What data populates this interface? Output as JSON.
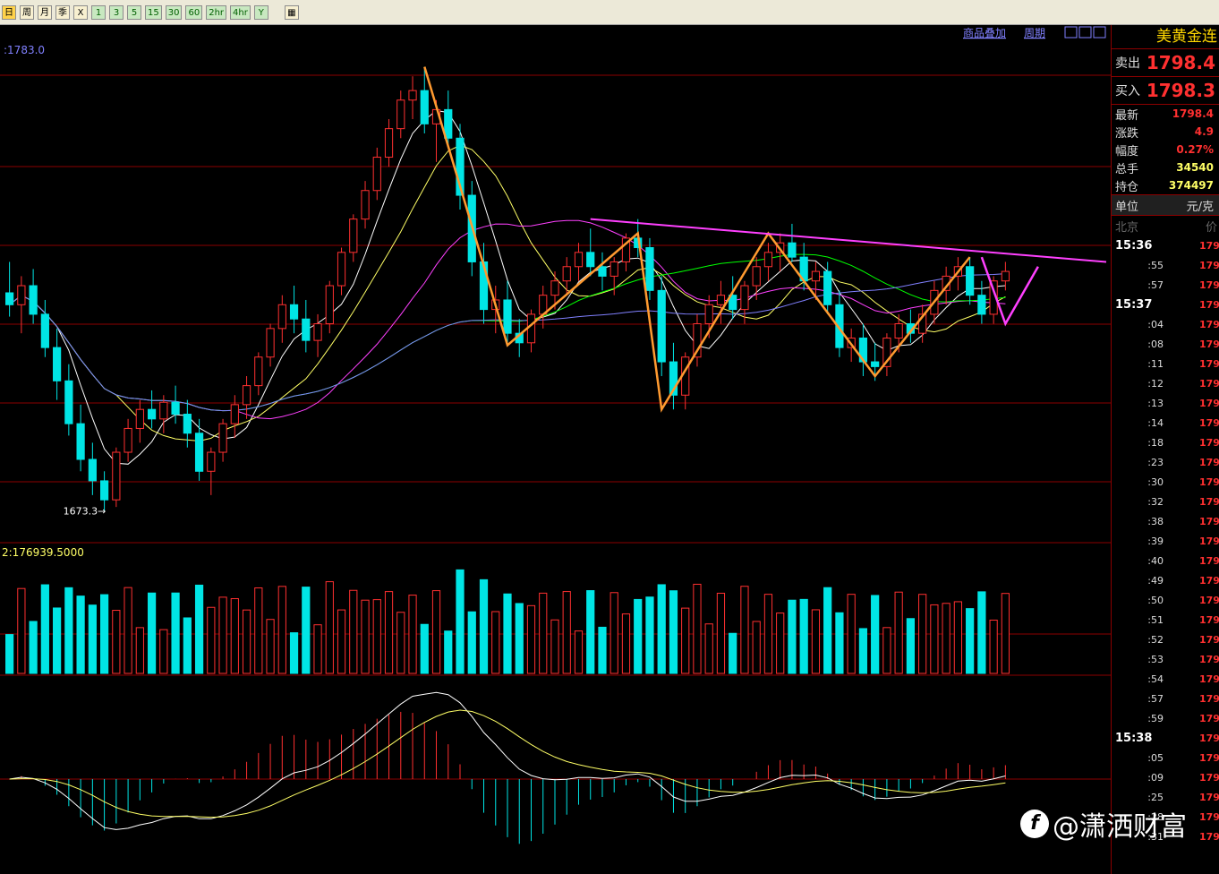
{
  "toolbar": {
    "buttons": [
      {
        "label": "日",
        "active": true
      },
      {
        "label": "周"
      },
      {
        "label": "月"
      },
      {
        "label": "季"
      },
      {
        "label": "X"
      },
      {
        "label": "1",
        "green": true
      },
      {
        "label": "3",
        "green": true
      },
      {
        "label": "5",
        "green": true
      },
      {
        "label": "15",
        "green": true
      },
      {
        "label": "30",
        "green": true
      },
      {
        "label": "60",
        "green": true
      },
      {
        "label": "2hr",
        "green": true
      },
      {
        "label": "4hr",
        "green": true
      },
      {
        "label": "Y",
        "green": true
      }
    ],
    "extra_icon": "grid-icon"
  },
  "chart_header": {
    "overlay_link": "商品叠加",
    "period_link": "周期",
    "nav_icons": [
      "prev-icon",
      "next-icon",
      "expand-icon"
    ]
  },
  "chart_data": {
    "type": "candlestick",
    "price_label": ":1783.0",
    "low_label": "1673.3",
    "volume_label": "2:176939.5000",
    "ohlc": [
      [
        1765,
        1778,
        1755,
        1760
      ],
      [
        1760,
        1772,
        1748,
        1768
      ],
      [
        1768,
        1775,
        1752,
        1756
      ],
      [
        1756,
        1762,
        1738,
        1742
      ],
      [
        1742,
        1750,
        1720,
        1728
      ],
      [
        1728,
        1735,
        1705,
        1710
      ],
      [
        1710,
        1718,
        1690,
        1695
      ],
      [
        1695,
        1702,
        1680,
        1686
      ],
      [
        1686,
        1690,
        1673.3,
        1678
      ],
      [
        1678,
        1700,
        1675,
        1698
      ],
      [
        1698,
        1712,
        1694,
        1708
      ],
      [
        1708,
        1720,
        1702,
        1716
      ],
      [
        1716,
        1724,
        1708,
        1712
      ],
      [
        1712,
        1722,
        1706,
        1719
      ],
      [
        1719,
        1726,
        1710,
        1714
      ],
      [
        1714,
        1720,
        1700,
        1706
      ],
      [
        1706,
        1712,
        1686,
        1690
      ],
      [
        1690,
        1700,
        1680,
        1698
      ],
      [
        1698,
        1712,
        1694,
        1710
      ],
      [
        1710,
        1722,
        1704,
        1718
      ],
      [
        1718,
        1730,
        1712,
        1726
      ],
      [
        1726,
        1740,
        1722,
        1738
      ],
      [
        1738,
        1752,
        1734,
        1750
      ],
      [
        1750,
        1764,
        1744,
        1760
      ],
      [
        1760,
        1768,
        1748,
        1754
      ],
      [
        1754,
        1762,
        1740,
        1745
      ],
      [
        1745,
        1756,
        1738,
        1752
      ],
      [
        1752,
        1770,
        1748,
        1768
      ],
      [
        1768,
        1784,
        1764,
        1782
      ],
      [
        1782,
        1798,
        1778,
        1796
      ],
      [
        1796,
        1812,
        1792,
        1808
      ],
      [
        1808,
        1826,
        1804,
        1822
      ],
      [
        1822,
        1838,
        1818,
        1834
      ],
      [
        1834,
        1850,
        1830,
        1846
      ],
      [
        1846,
        1856,
        1838,
        1850
      ],
      [
        1850,
        1860,
        1832,
        1836
      ],
      [
        1836,
        1846,
        1820,
        1842
      ],
      [
        1842,
        1850,
        1826,
        1830
      ],
      [
        1830,
        1836,
        1800,
        1806
      ],
      [
        1806,
        1812,
        1772,
        1778
      ],
      [
        1778,
        1786,
        1752,
        1758
      ],
      [
        1758,
        1768,
        1748,
        1762
      ],
      [
        1762,
        1770,
        1744,
        1748
      ],
      [
        1748,
        1754,
        1738,
        1744
      ],
      [
        1744,
        1758,
        1740,
        1756
      ],
      [
        1756,
        1768,
        1750,
        1764
      ],
      [
        1764,
        1774,
        1758,
        1770
      ],
      [
        1770,
        1780,
        1764,
        1776
      ],
      [
        1776,
        1786,
        1770,
        1782
      ],
      [
        1782,
        1792,
        1772,
        1776
      ],
      [
        1776,
        1782,
        1766,
        1772
      ],
      [
        1772,
        1780,
        1764,
        1778
      ],
      [
        1778,
        1790,
        1774,
        1788
      ],
      [
        1788,
        1796,
        1780,
        1784
      ],
      [
        1784,
        1788,
        1762,
        1766
      ],
      [
        1766,
        1772,
        1730,
        1736
      ],
      [
        1736,
        1744,
        1716,
        1722
      ],
      [
        1722,
        1740,
        1716,
        1738
      ],
      [
        1738,
        1756,
        1734,
        1752
      ],
      [
        1752,
        1764,
        1746,
        1760
      ],
      [
        1760,
        1770,
        1752,
        1764
      ],
      [
        1764,
        1772,
        1754,
        1758
      ],
      [
        1758,
        1770,
        1752,
        1768
      ],
      [
        1768,
        1780,
        1762,
        1776
      ],
      [
        1776,
        1786,
        1770,
        1782
      ],
      [
        1782,
        1790,
        1774,
        1786
      ],
      [
        1786,
        1794,
        1778,
        1780
      ],
      [
        1780,
        1786,
        1766,
        1770
      ],
      [
        1770,
        1778,
        1762,
        1774
      ],
      [
        1774,
        1778,
        1756,
        1760
      ],
      [
        1760,
        1766,
        1738,
        1742
      ],
      [
        1742,
        1750,
        1736,
        1746
      ],
      [
        1746,
        1752,
        1730,
        1736
      ],
      [
        1736,
        1744,
        1728,
        1734
      ],
      [
        1734,
        1748,
        1730,
        1746
      ],
      [
        1746,
        1756,
        1740,
        1752
      ],
      [
        1752,
        1758,
        1744,
        1748
      ],
      [
        1748,
        1760,
        1744,
        1756
      ],
      [
        1756,
        1770,
        1752,
        1766
      ],
      [
        1766,
        1776,
        1760,
        1772
      ],
      [
        1772,
        1780,
        1766,
        1776
      ],
      [
        1776,
        1780,
        1760,
        1764
      ],
      [
        1764,
        1770,
        1752,
        1756
      ],
      [
        1756,
        1772,
        1752,
        1770
      ],
      [
        1770,
        1778,
        1766,
        1774
      ]
    ],
    "ma_colors": [
      "#FFFFFF",
      "#FFFF66",
      "#FF40FF",
      "#00FF00",
      "#8080FF"
    ],
    "trend_lines": {
      "orange_color": "#FF9A30",
      "magenta_color": "#FF40FF"
    }
  },
  "sidebar": {
    "title": "美黄金连",
    "sell_label": "卖出",
    "sell_value": "1798.4",
    "buy_label": "买入",
    "buy_value": "1798.3",
    "info": [
      {
        "label": "最新",
        "value": "1798.4",
        "color": "#FF3030"
      },
      {
        "label": "涨跌",
        "value": "4.9",
        "color": "#FF3030"
      },
      {
        "label": "幅度",
        "value": "0.27%",
        "color": "#FF3030"
      },
      {
        "label": "总手",
        "value": "34540",
        "color": "#FFFF66"
      },
      {
        "label": "持仓",
        "value": "374497",
        "color": "#FFFF66"
      }
    ],
    "unit_label": "单位",
    "unit_value": "元/克",
    "ticks_head_left": "北京",
    "ticks_head_right": "价",
    "ticks": [
      {
        "t": "15:36",
        "major": true
      },
      {
        "t": ":55"
      },
      {
        "t": ":57"
      },
      {
        "t": "15:37",
        "major": true
      },
      {
        "t": ":04"
      },
      {
        "t": ":08"
      },
      {
        "t": ":11"
      },
      {
        "t": ":12"
      },
      {
        "t": ":13"
      },
      {
        "t": ":14"
      },
      {
        "t": ":18"
      },
      {
        "t": ":23"
      },
      {
        "t": ":30"
      },
      {
        "t": ":32"
      },
      {
        "t": ":38"
      },
      {
        "t": ":39"
      },
      {
        "t": ":40"
      },
      {
        "t": ":49"
      },
      {
        "t": ":50"
      },
      {
        "t": ":51"
      },
      {
        "t": ":52"
      },
      {
        "t": ":53"
      },
      {
        "t": ":54"
      },
      {
        "t": ":57"
      },
      {
        "t": ":59"
      },
      {
        "t": "15:38",
        "major": true
      },
      {
        "t": ":05"
      },
      {
        "t": ":09"
      },
      {
        "t": ":25"
      },
      {
        "t": ":28"
      },
      {
        "t": ":31"
      }
    ],
    "tick_price": "179"
  },
  "watermark": {
    "logo": "f",
    "text": "@潇洒财富"
  }
}
